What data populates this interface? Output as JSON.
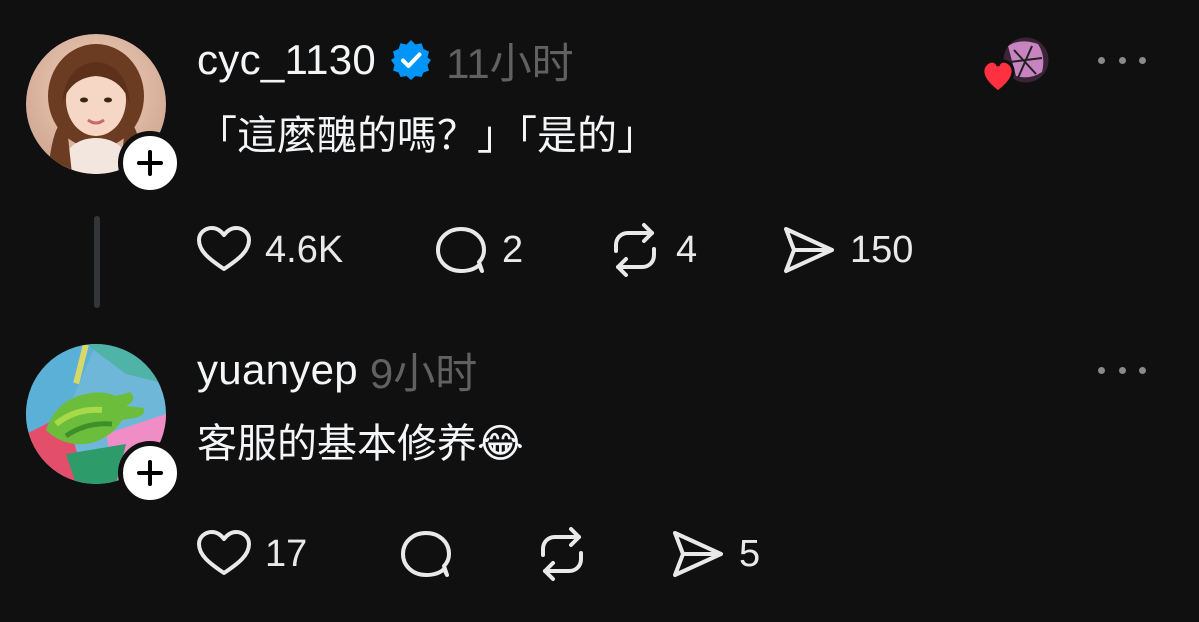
{
  "posts": [
    {
      "username": "cyc_1130",
      "verified": true,
      "timestamp": "11小时",
      "text": "「這麼醜的嗎？」「是的」",
      "likes": "4.6K",
      "replies": "2",
      "reposts": "4",
      "shares": "150"
    },
    {
      "username": "yuanyep",
      "verified": false,
      "timestamp": "9小时",
      "text": "客服的基本修养😂",
      "likes": "17",
      "replies": "",
      "reposts": "",
      "shares": "5"
    }
  ],
  "icons": {
    "follow": "plus-icon",
    "verified": "verified-badge-icon",
    "like": "heart-icon",
    "reply": "comment-bubble-icon",
    "repost": "repost-icon",
    "share": "send-icon",
    "more": "more-dots-icon"
  },
  "colors": {
    "background": "#101010",
    "text": "#f3f5f7",
    "muted": "#616161",
    "verified": "#0095f6",
    "heart": "#ff3040"
  }
}
